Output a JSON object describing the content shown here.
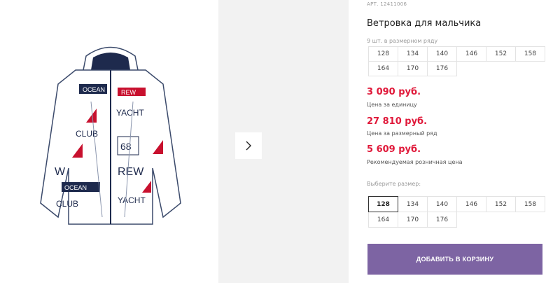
{
  "product": {
    "article": "АРТ. 12411006",
    "title": "Ветровка для мальчика",
    "image_icon": "jacket-image"
  },
  "series": {
    "label": "9 шт. в размерном ряду",
    "sizes": [
      "128",
      "134",
      "140",
      "146",
      "152",
      "158",
      "164",
      "170",
      "176"
    ]
  },
  "prices": {
    "unit_price": "3 090 руб.",
    "unit_note": "Цена за единицу",
    "series_price": "27 810 руб.",
    "series_note": "Цена за размерный ряд",
    "retail_price": "5 609 руб.",
    "retail_note": "Рекомендуемая розничная цена"
  },
  "size_select": {
    "label": "Выберите размер:",
    "sizes": [
      "128",
      "134",
      "140",
      "146",
      "152",
      "158",
      "164",
      "170",
      "176"
    ],
    "selected": "128"
  },
  "cart": {
    "button_label": "ДОБАВИТЬ В КОРЗИНУ"
  },
  "colors": {
    "price_red": "#e0193a",
    "button_purple": "#7d64a3",
    "strip_gray": "#f2f2f2"
  },
  "gallery": {
    "next_icon": "chevron-right-icon"
  }
}
